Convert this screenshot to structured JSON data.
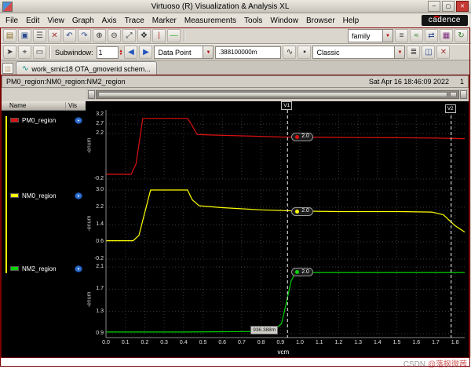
{
  "window": {
    "title": "Virtuoso (R) Visualization & Analysis XL"
  },
  "menu": {
    "items": [
      "File",
      "Edit",
      "View",
      "Graph",
      "Axis",
      "Trace",
      "Marker",
      "Measurements",
      "Tools",
      "Window",
      "Browser",
      "Help"
    ]
  },
  "brand": {
    "logo_text": "cādence"
  },
  "toolbar_main": {
    "left_icons": [
      {
        "name": "open-icon",
        "glyph": "▤",
        "color": "#8a6d2a"
      },
      {
        "name": "save-icon",
        "glyph": "▣",
        "color": "#2a4a8a"
      },
      {
        "name": "print-icon",
        "glyph": "☰",
        "color": "#444444"
      },
      {
        "name": "delete-icon",
        "glyph": "✕",
        "color": "#aa3333"
      },
      {
        "name": "undo-icon",
        "glyph": "↶",
        "color": "#2a4a8a"
      },
      {
        "name": "redo-icon",
        "glyph": "↷",
        "color": "#2a4a8a"
      },
      {
        "name": "zoom-in-icon",
        "glyph": "⊕",
        "color": "#333333"
      },
      {
        "name": "zoom-out-icon",
        "glyph": "⊖",
        "color": "#333333"
      },
      {
        "name": "zoom-fit-icon",
        "glyph": "⤢",
        "color": "#333333"
      },
      {
        "name": "pan-icon",
        "glyph": "✥",
        "color": "#333333"
      },
      {
        "name": "vertical-marker-icon",
        "glyph": "|",
        "color": "#bb2222"
      },
      {
        "name": "horizontal-marker-icon",
        "glyph": "—",
        "color": "#22aa22"
      }
    ],
    "family_combo": {
      "value": "family"
    },
    "right_icons": [
      {
        "name": "strips-mode-icon",
        "glyph": "≡",
        "color": "#444444"
      },
      {
        "name": "overlay-mode-icon",
        "glyph": "≈",
        "color": "#2a7a2a"
      },
      {
        "name": "swap-sweep-icon",
        "glyph": "⇄",
        "color": "#2a4a8a"
      },
      {
        "name": "table-icon",
        "glyph": "▦",
        "color": "#7a2a7a"
      },
      {
        "name": "refresh-icon",
        "glyph": "↻",
        "color": "#2a7a2a"
      }
    ]
  },
  "toolbar_sub": {
    "left_icons": [
      {
        "name": "pointer-mode-icon",
        "glyph": "➤",
        "color": "#333333"
      },
      {
        "name": "crosshair-mode-icon",
        "glyph": "⌖",
        "color": "#333333"
      },
      {
        "name": "zoom-region-icon",
        "glyph": "▭",
        "color": "#333333"
      }
    ],
    "subwindow_label": "Subwindow:",
    "subwindow_value": "1",
    "nav_icons": [
      {
        "name": "back-icon",
        "glyph": "◀",
        "color": "#2255bb"
      },
      {
        "name": "forward-icon",
        "glyph": "▶",
        "color": "#2255bb"
      }
    ],
    "mode_combo": {
      "value": "Data Point"
    },
    "value_field": {
      "value": ".388100000m"
    },
    "mid_icons": [
      {
        "name": "snap-toggle-icon",
        "glyph": "∿",
        "color": "#333333"
      },
      {
        "name": "lock-icon",
        "glyph": "▪",
        "color": "#333333"
      }
    ],
    "style_combo": {
      "value": "Classic"
    },
    "right_icons": [
      {
        "name": "new-strip-icon",
        "glyph": "≣",
        "color": "#444444"
      },
      {
        "name": "split-window-icon",
        "glyph": "◫",
        "color": "#2a4a8a"
      },
      {
        "name": "close-subwindow-icon",
        "glyph": "✕",
        "color": "#aa3333"
      }
    ]
  },
  "tabs": {
    "active_tab": {
      "label": "work_smic18 OTA_gmoverid schem..."
    }
  },
  "graph_window": {
    "title": "PM0_region:NM0_region:NM2_region",
    "timestamp": "Sat Apr 16 18:46:09 2022",
    "page_number": "1"
  },
  "legend": {
    "columns": {
      "name": "Name",
      "vis": "Vis"
    },
    "items": [
      {
        "label": "PM0_region",
        "color": "#dd1111"
      },
      {
        "label": "NM0_region",
        "color": "#ffff00"
      },
      {
        "label": "NM2_region",
        "color": "#00d400"
      }
    ]
  },
  "chart_data": {
    "type": "line",
    "title": "PM0_region:NM0_region:NM2_region",
    "xlabel": "vcm",
    "x_range": [
      0,
      1.85
    ],
    "x_ticks": [
      0.0,
      0.1,
      0.2,
      0.3,
      0.4,
      0.5,
      0.6,
      0.7,
      0.8,
      0.9,
      1.0,
      1.1,
      1.2,
      1.3,
      1.4,
      1.5,
      1.6,
      1.7,
      1.8
    ],
    "grid": true,
    "markers": {
      "v1": {
        "label": "V1",
        "x": 0.936
      },
      "v2": {
        "label": "V2",
        "x": 1.78
      },
      "intercept_label": "936.388m"
    },
    "strips": [
      {
        "name": "PM0_region",
        "color": "#dd1111",
        "y_label": "-enum",
        "y_range": [
          -0.2,
          3.2
        ],
        "y_ticks": [
          3.2,
          2.7,
          2.2,
          -0.2
        ],
        "marker_value": "2.0",
        "series": {
          "x": [
            0,
            0.13,
            0.155,
            0.19,
            0.42,
            0.44,
            0.47,
            0.55,
            0.7,
            0.9,
            1.1,
            1.3,
            1.5,
            1.7,
            1.85
          ],
          "y": [
            0.05,
            0.05,
            0.6,
            3.0,
            3.0,
            2.7,
            2.15,
            2.12,
            2.08,
            2.02,
            2.0,
            1.99,
            1.98,
            1.96,
            1.93
          ]
        }
      },
      {
        "name": "NM0_region",
        "color": "#ffff00",
        "y_label": "-enum",
        "y_range": [
          -0.2,
          3.0
        ],
        "y_ticks": [
          3.0,
          2.2,
          1.4,
          0.6,
          -0.2
        ],
        "marker_value": "2.0",
        "series": {
          "x": [
            0,
            0.14,
            0.17,
            0.23,
            0.42,
            0.445,
            0.48,
            0.6,
            0.8,
            1.0,
            1.2,
            1.5,
            1.68,
            1.74,
            1.8,
            1.85
          ],
          "y": [
            0.65,
            0.65,
            0.9,
            3.0,
            3.0,
            2.55,
            2.27,
            2.18,
            2.08,
            2.02,
            2.0,
            2.0,
            1.98,
            1.85,
            1.35,
            1.05
          ]
        }
      },
      {
        "name": "NM2_region",
        "color": "#00d400",
        "y_label": "-enum",
        "y_range": [
          0.9,
          2.1
        ],
        "y_ticks": [
          2.1,
          1.7,
          1.3,
          0.9
        ],
        "marker_value": "2.0",
        "series": {
          "x": [
            0,
            0.4,
            0.8,
            0.87,
            0.905,
            0.93,
            0.955,
            0.975,
            1.0,
            1.2,
            1.5,
            1.85
          ],
          "y": [
            0.93,
            0.93,
            0.94,
            0.97,
            1.08,
            1.45,
            1.85,
            1.98,
            2.0,
            2.0,
            2.0,
            2.0
          ]
        }
      }
    ]
  },
  "watermark": {
    "prefix": "CSDN ",
    "handle": "@落枫微茜"
  }
}
